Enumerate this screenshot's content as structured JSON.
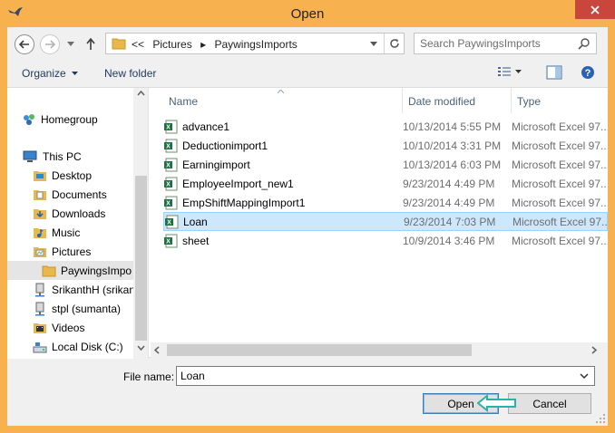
{
  "window": {
    "title": "Open"
  },
  "address": {
    "overflow": "<<",
    "crumbs": [
      "Pictures",
      "PaywingsImports"
    ]
  },
  "search": {
    "placeholder": "Search PaywingsImports"
  },
  "toolbar": {
    "organize_label": "Organize",
    "new_folder_label": "New folder"
  },
  "nav": {
    "homegroup": "Homegroup",
    "this_pc": "This PC",
    "items": [
      {
        "label": "Desktop",
        "icon": "desktop-folder-icon"
      },
      {
        "label": "Documents",
        "icon": "documents-folder-icon"
      },
      {
        "label": "Downloads",
        "icon": "downloads-folder-icon"
      },
      {
        "label": "Music",
        "icon": "music-folder-icon"
      },
      {
        "label": "Pictures",
        "icon": "pictures-folder-icon"
      },
      {
        "label": "PaywingsImpo",
        "icon": "folder-icon"
      },
      {
        "label": "SrikanthH (srikan",
        "icon": "network-drive-icon"
      },
      {
        "label": "stpl (sumanta)",
        "icon": "network-drive-icon"
      },
      {
        "label": "Videos",
        "icon": "videos-folder-icon"
      },
      {
        "label": "Local Disk (C:)",
        "icon": "local-disk-icon"
      }
    ]
  },
  "columns": {
    "name": "Name",
    "date": "Date modified",
    "type": "Type"
  },
  "files": [
    {
      "name": "advance1",
      "date": "10/13/2014 5:55 PM",
      "type": "Microsoft Excel 97..."
    },
    {
      "name": "Deductionimport1",
      "date": "10/10/2014 3:31 PM",
      "type": "Microsoft Excel 97..."
    },
    {
      "name": "Earningimport",
      "date": "10/13/2014 6:03 PM",
      "type": "Microsoft Excel 97..."
    },
    {
      "name": "EmployeeImport_new1",
      "date": "9/23/2014 4:49 PM",
      "type": "Microsoft Excel 97..."
    },
    {
      "name": "EmpShiftMappingImport1",
      "date": "9/23/2014 4:49 PM",
      "type": "Microsoft Excel 97..."
    },
    {
      "name": "Loan",
      "date": "9/23/2014 7:03 PM",
      "type": "Microsoft Excel 97..."
    },
    {
      "name": "sheet",
      "date": "10/9/2014 3:46 PM",
      "type": "Microsoft Excel 97..."
    }
  ],
  "selected_file": "Loan",
  "filename": {
    "label": "File name:",
    "value": "Loan"
  },
  "buttons": {
    "open": "Open",
    "cancel": "Cancel"
  },
  "colors": {
    "frame": "#f7b14e",
    "close": "#c9463d",
    "selection": "#cce8ff",
    "callout": "#27b3a5"
  }
}
